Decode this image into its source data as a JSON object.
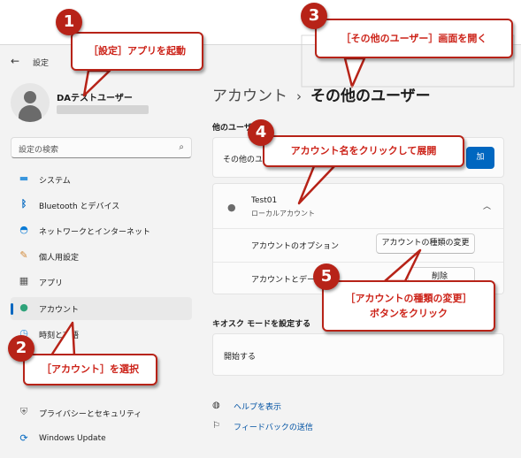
{
  "window": {
    "title": "設定",
    "back_glyph": "←"
  },
  "profile": {
    "name": "DAテストユーザー"
  },
  "search": {
    "placeholder": "設定の検索",
    "icon_glyph": "⌕"
  },
  "nav": {
    "items": [
      {
        "label": "システム",
        "icon": "monitor-icon",
        "glyph": "▬",
        "color": "#3a96dd"
      },
      {
        "label": "Bluetooth とデバイス",
        "icon": "bluetooth-icon",
        "glyph": "ᛒ",
        "color": "#0067c0"
      },
      {
        "label": "ネットワークとインターネット",
        "icon": "wifi-icon",
        "glyph": "◓",
        "color": "#0a7bd6"
      },
      {
        "label": "個人用設定",
        "icon": "brush-icon",
        "glyph": "✎",
        "color": "#d28a3a"
      },
      {
        "label": "アプリ",
        "icon": "apps-icon",
        "glyph": "▦",
        "color": "#555555"
      },
      {
        "label": "アカウント",
        "icon": "account-icon",
        "glyph": "●",
        "color": "#2fa37a"
      },
      {
        "label": "時刻と言語",
        "icon": "clock-icon",
        "glyph": "◷",
        "color": "#3a96dd"
      },
      {
        "label": "プライバシーとセキュリティ",
        "icon": "shield-icon",
        "glyph": "⛨",
        "color": "#6b6b6b"
      },
      {
        "label": "Windows Update",
        "icon": "update-icon",
        "glyph": "⟳",
        "color": "#0067c0"
      }
    ]
  },
  "main": {
    "breadcrumb_parent": "アカウント",
    "breadcrumb_sep": "›",
    "breadcrumb_current": "その他のユーザー",
    "other_users_label": "他のユーザー",
    "add_row_label": "その他のユーザーを追加する",
    "add_button": "加",
    "account": {
      "name": "Test01",
      "type": "ローカルアカウント",
      "options_label": "アカウントのオプション",
      "change_type_button": "アカウントの種類の変更",
      "data_label": "アカウントとデータ",
      "delete_button": "削除"
    },
    "kiosk_label": "キオスク モードを設定する",
    "kiosk_row": "開始する",
    "links": [
      {
        "label": "ヘルプを表示",
        "icon": "help-icon",
        "glyph": "◍"
      },
      {
        "label": "フィードバックの送信",
        "icon": "feedback-icon",
        "glyph": "⚐"
      }
    ]
  },
  "annotations": [
    {
      "number": "1",
      "text": "［設定］アプリを起動"
    },
    {
      "number": "2",
      "text": "［アカウント］を選択"
    },
    {
      "number": "3",
      "text": "［その他のユーザー］画面を開く"
    },
    {
      "number": "4",
      "text": "アカウント名をクリックして展開"
    },
    {
      "number": "5",
      "line1": "［アカウントの種類の変更］",
      "line2": "ボタンをクリック"
    }
  ],
  "colors": {
    "accent": "#0067c0",
    "annotation_red": "#b72318",
    "annotation_text": "#cc2218"
  }
}
